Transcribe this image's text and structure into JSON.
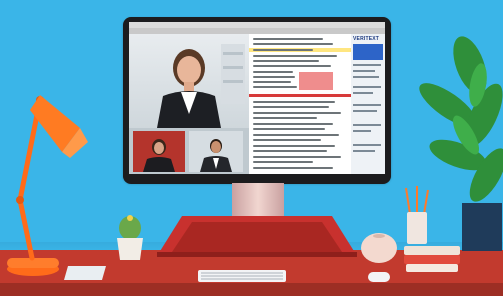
{
  "scene": {
    "description_hidden": ""
  },
  "monitor_screen": {
    "brand_text": "VERITEXT",
    "app_tabs": [
      "",
      "",
      "",
      ""
    ]
  },
  "colors": {
    "wall": "#3ab5e8",
    "desk": "#c23a2e",
    "lamp": "#ff6b1a",
    "plant": "#2f8f3a",
    "stand": "#c8312e"
  },
  "icons": {
    "lamp": "desk-lamp-icon",
    "cactus": "cactus-icon",
    "vase": "vase-icon",
    "pencil_cup": "pencil-cup-icon",
    "books": "books-icon",
    "keyboard": "keyboard-icon",
    "plant": "plant-icon"
  }
}
